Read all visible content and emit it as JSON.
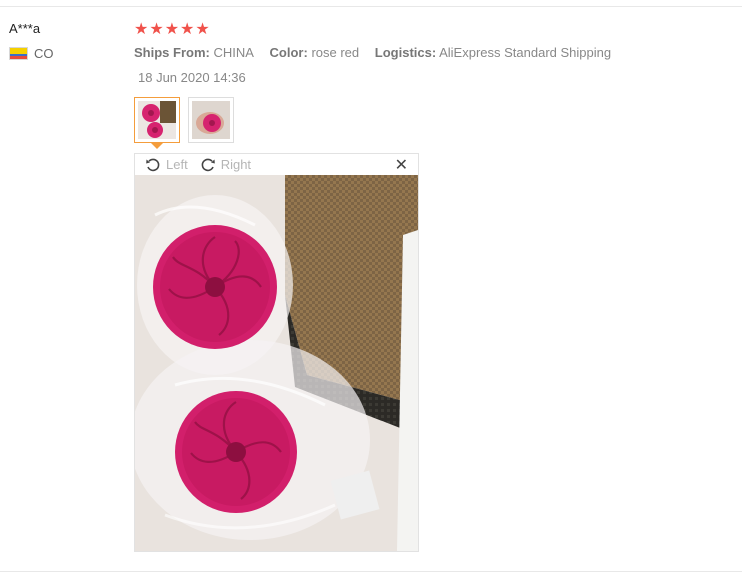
{
  "review": {
    "user_name": "A***a",
    "country_code": "CO",
    "rating": 5,
    "ships_from_label": "Ships From:",
    "ships_from_value": "CHINA",
    "color_label": "Color:",
    "color_value": "rose red",
    "logistics_label": "Logistics:",
    "logistics_value": "AliExpress Standard Shipping",
    "date": "18 Jun 2020 14:36"
  },
  "viewer": {
    "rotate_left_label": "Left",
    "rotate_right_label": "Right",
    "close_glyph": "✕"
  },
  "icons": {
    "star": "star-icon",
    "rotate_left": "rotate-left-icon",
    "rotate_right": "rotate-right-icon",
    "close": "close-icon",
    "flag": "colombia-flag-icon"
  },
  "colors": {
    "star": "#f0524b",
    "active_thumb_border": "#f49d3c",
    "product": "#d6236f"
  }
}
